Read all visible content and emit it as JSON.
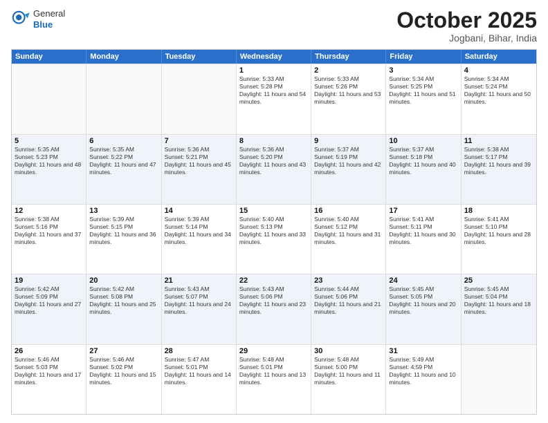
{
  "header": {
    "logo_general": "General",
    "logo_blue": "Blue",
    "month": "October 2025",
    "location": "Jogbani, Bihar, India"
  },
  "days_of_week": [
    "Sunday",
    "Monday",
    "Tuesday",
    "Wednesday",
    "Thursday",
    "Friday",
    "Saturday"
  ],
  "weeks": [
    [
      {
        "day": "",
        "empty": true
      },
      {
        "day": "",
        "empty": true
      },
      {
        "day": "",
        "empty": true
      },
      {
        "day": "1",
        "sunrise": "5:33 AM",
        "sunset": "5:28 PM",
        "daylight": "11 hours and 54 minutes."
      },
      {
        "day": "2",
        "sunrise": "5:33 AM",
        "sunset": "5:26 PM",
        "daylight": "11 hours and 53 minutes."
      },
      {
        "day": "3",
        "sunrise": "5:34 AM",
        "sunset": "5:25 PM",
        "daylight": "11 hours and 51 minutes."
      },
      {
        "day": "4",
        "sunrise": "5:34 AM",
        "sunset": "5:24 PM",
        "daylight": "11 hours and 50 minutes."
      }
    ],
    [
      {
        "day": "5",
        "sunrise": "5:35 AM",
        "sunset": "5:23 PM",
        "daylight": "11 hours and 48 minutes."
      },
      {
        "day": "6",
        "sunrise": "5:35 AM",
        "sunset": "5:22 PM",
        "daylight": "11 hours and 47 minutes."
      },
      {
        "day": "7",
        "sunrise": "5:36 AM",
        "sunset": "5:21 PM",
        "daylight": "11 hours and 45 minutes."
      },
      {
        "day": "8",
        "sunrise": "5:36 AM",
        "sunset": "5:20 PM",
        "daylight": "11 hours and 43 minutes."
      },
      {
        "day": "9",
        "sunrise": "5:37 AM",
        "sunset": "5:19 PM",
        "daylight": "11 hours and 42 minutes."
      },
      {
        "day": "10",
        "sunrise": "5:37 AM",
        "sunset": "5:18 PM",
        "daylight": "11 hours and 40 minutes."
      },
      {
        "day": "11",
        "sunrise": "5:38 AM",
        "sunset": "5:17 PM",
        "daylight": "11 hours and 39 minutes."
      }
    ],
    [
      {
        "day": "12",
        "sunrise": "5:38 AM",
        "sunset": "5:16 PM",
        "daylight": "11 hours and 37 minutes."
      },
      {
        "day": "13",
        "sunrise": "5:39 AM",
        "sunset": "5:15 PM",
        "daylight": "11 hours and 36 minutes."
      },
      {
        "day": "14",
        "sunrise": "5:39 AM",
        "sunset": "5:14 PM",
        "daylight": "11 hours and 34 minutes."
      },
      {
        "day": "15",
        "sunrise": "5:40 AM",
        "sunset": "5:13 PM",
        "daylight": "11 hours and 33 minutes."
      },
      {
        "day": "16",
        "sunrise": "5:40 AM",
        "sunset": "5:12 PM",
        "daylight": "11 hours and 31 minutes."
      },
      {
        "day": "17",
        "sunrise": "5:41 AM",
        "sunset": "5:11 PM",
        "daylight": "11 hours and 30 minutes."
      },
      {
        "day": "18",
        "sunrise": "5:41 AM",
        "sunset": "5:10 PM",
        "daylight": "11 hours and 28 minutes."
      }
    ],
    [
      {
        "day": "19",
        "sunrise": "5:42 AM",
        "sunset": "5:09 PM",
        "daylight": "11 hours and 27 minutes."
      },
      {
        "day": "20",
        "sunrise": "5:42 AM",
        "sunset": "5:08 PM",
        "daylight": "11 hours and 25 minutes."
      },
      {
        "day": "21",
        "sunrise": "5:43 AM",
        "sunset": "5:07 PM",
        "daylight": "11 hours and 24 minutes."
      },
      {
        "day": "22",
        "sunrise": "5:43 AM",
        "sunset": "5:06 PM",
        "daylight": "11 hours and 23 minutes."
      },
      {
        "day": "23",
        "sunrise": "5:44 AM",
        "sunset": "5:06 PM",
        "daylight": "11 hours and 21 minutes."
      },
      {
        "day": "24",
        "sunrise": "5:45 AM",
        "sunset": "5:05 PM",
        "daylight": "11 hours and 20 minutes."
      },
      {
        "day": "25",
        "sunrise": "5:45 AM",
        "sunset": "5:04 PM",
        "daylight": "11 hours and 18 minutes."
      }
    ],
    [
      {
        "day": "26",
        "sunrise": "5:46 AM",
        "sunset": "5:03 PM",
        "daylight": "11 hours and 17 minutes."
      },
      {
        "day": "27",
        "sunrise": "5:46 AM",
        "sunset": "5:02 PM",
        "daylight": "11 hours and 15 minutes."
      },
      {
        "day": "28",
        "sunrise": "5:47 AM",
        "sunset": "5:01 PM",
        "daylight": "11 hours and 14 minutes."
      },
      {
        "day": "29",
        "sunrise": "5:48 AM",
        "sunset": "5:01 PM",
        "daylight": "11 hours and 13 minutes."
      },
      {
        "day": "30",
        "sunrise": "5:48 AM",
        "sunset": "5:00 PM",
        "daylight": "11 hours and 11 minutes."
      },
      {
        "day": "31",
        "sunrise": "5:49 AM",
        "sunset": "4:59 PM",
        "daylight": "11 hours and 10 minutes."
      },
      {
        "day": "",
        "empty": true
      }
    ]
  ]
}
